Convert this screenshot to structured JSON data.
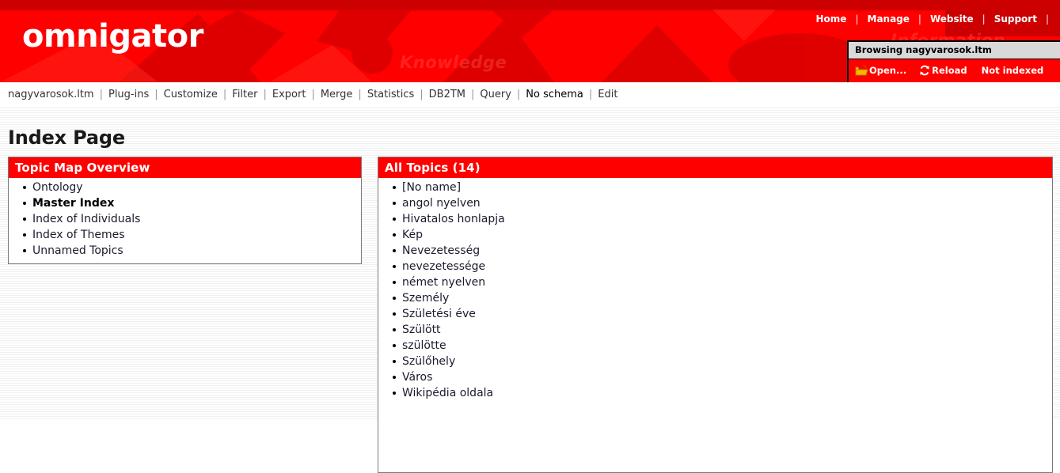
{
  "header": {
    "logo": "omnigator",
    "watermark_words": [
      "Knowledge",
      "Information"
    ],
    "topnav": [
      {
        "label": "Home"
      },
      {
        "label": "Manage"
      },
      {
        "label": "Website"
      },
      {
        "label": "Support"
      }
    ],
    "browsing": {
      "title": "Browsing nagyvarosok.ltm",
      "open_label": "Open...",
      "open_icon": "folder-open-icon",
      "reload_label": "Reload",
      "reload_icon": "reload-icon",
      "index_status": "Not indexed"
    },
    "colors": {
      "brand_red": "#ff0000",
      "brand_dark_red": "#cc0000",
      "title_bar_gray": "#d9d9d9"
    }
  },
  "menubar": {
    "items": [
      {
        "label": "nagyvarosok.ltm",
        "current": false
      },
      {
        "label": "Plug-ins",
        "current": false
      },
      {
        "label": "Customize",
        "current": false
      },
      {
        "label": "Filter",
        "current": false
      },
      {
        "label": "Export",
        "current": false
      },
      {
        "label": "Merge",
        "current": false
      },
      {
        "label": "Statistics",
        "current": false
      },
      {
        "label": "DB2TM",
        "current": false
      },
      {
        "label": "Query",
        "current": false
      },
      {
        "label": "No schema",
        "current": true
      },
      {
        "label": "Edit",
        "current": false
      }
    ],
    "separator": "|"
  },
  "main": {
    "page_title": "Index Page",
    "overview_panel": {
      "title": "Topic Map Overview",
      "items": [
        {
          "label": "Ontology",
          "bold": false
        },
        {
          "label": "Master Index",
          "bold": true
        },
        {
          "label": "Index of Individuals",
          "bold": false
        },
        {
          "label": "Index of Themes",
          "bold": false
        },
        {
          "label": "Unnamed Topics",
          "bold": false
        }
      ]
    },
    "topics_panel": {
      "title": "All Topics (14)",
      "count": 14,
      "items": [
        {
          "label": "[No name]"
        },
        {
          "label": "angol nyelven"
        },
        {
          "label": "Hivatalos honlapja"
        },
        {
          "label": "Kép"
        },
        {
          "label": "Nevezetesség"
        },
        {
          "label": "nevezetessége"
        },
        {
          "label": "német nyelven"
        },
        {
          "label": "Személy"
        },
        {
          "label": "Születési éve"
        },
        {
          "label": "Szülött"
        },
        {
          "label": "szülötte"
        },
        {
          "label": "Szülőhely"
        },
        {
          "label": "Város"
        },
        {
          "label": "Wikipédia oldala"
        }
      ]
    }
  }
}
